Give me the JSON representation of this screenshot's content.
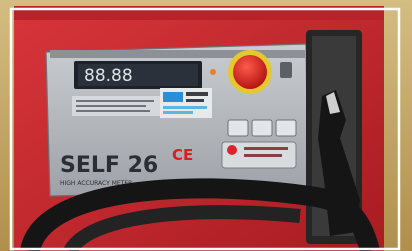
{
  "photo": {
    "display_digits": "88.88",
    "brand_text": "SELF 26",
    "model_suffix": "CE",
    "subtitle": "HIGH ACCURACY METER",
    "colors": {
      "housing_red": "#c7262b",
      "panel_grey": "#b9bcc0",
      "display_dark": "#1d2128",
      "button_red": "#d61f1f",
      "hose_black": "#151515",
      "background_tan": "#c9b072"
    }
  }
}
